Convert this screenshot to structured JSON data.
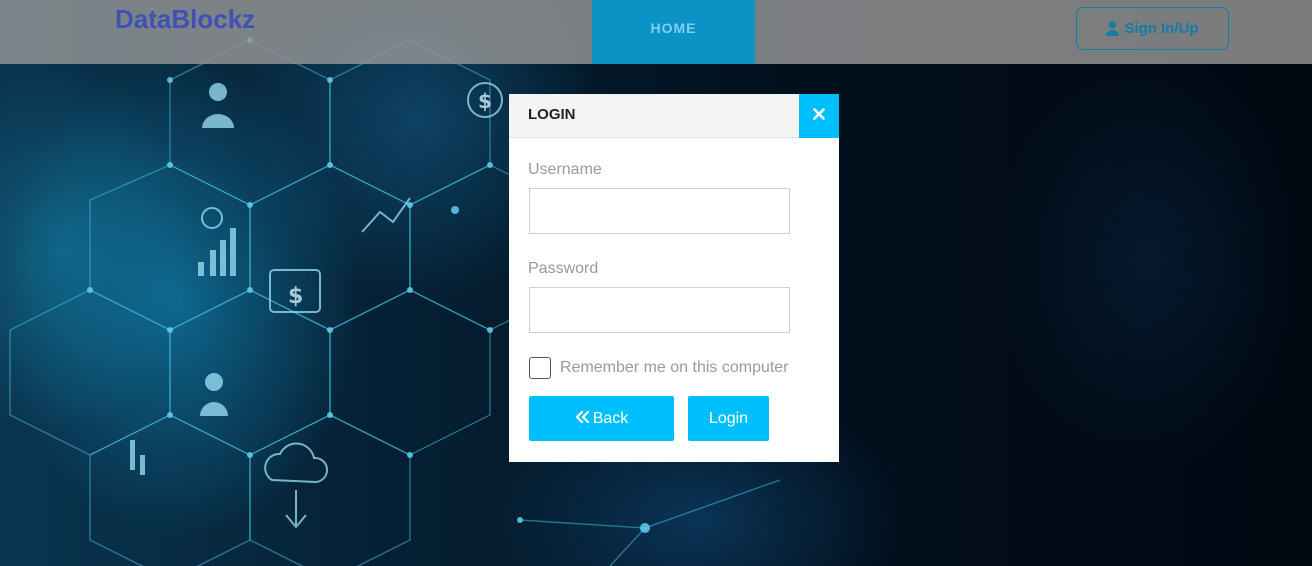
{
  "header": {
    "brand": "DataBlockz",
    "nav": {
      "home_label": "HOME"
    },
    "signin": {
      "label": "Sign In/Up",
      "icon": "user-icon"
    }
  },
  "modal": {
    "title": "LOGIN",
    "close_icon": "close-icon",
    "username": {
      "label": "Username",
      "value": ""
    },
    "password": {
      "label": "Password",
      "value": ""
    },
    "remember": {
      "label": "Remember me on this computer",
      "checked": false
    },
    "back_button": {
      "label": "Back",
      "icon": "double-chevron-left-icon"
    },
    "login_button": {
      "label": "Login"
    }
  },
  "colors": {
    "brand": "#3f51b5",
    "nav_active": "#0b93c6",
    "accent": "#00bfff",
    "outline_button": "#127ca7"
  }
}
